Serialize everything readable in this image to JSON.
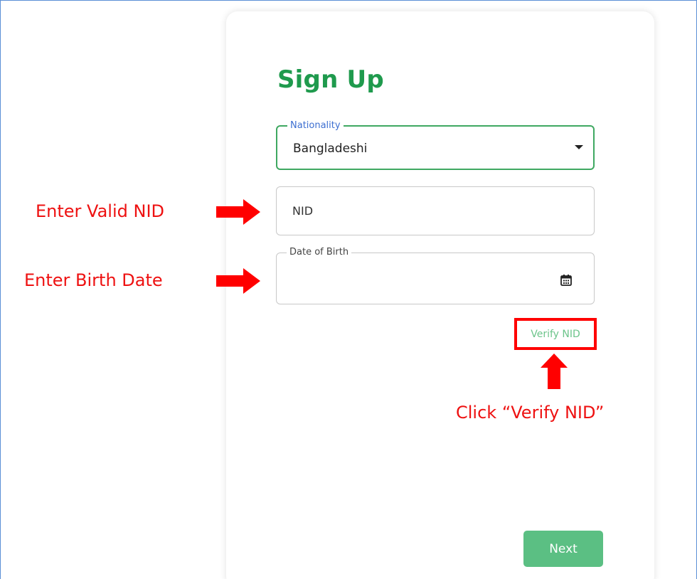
{
  "signup": {
    "title": "Sign Up",
    "nationality": {
      "label": "Nationality",
      "value": "Bangladeshi"
    },
    "nid": {
      "placeholder": "NID",
      "value": ""
    },
    "dob": {
      "label": "Date of Birth",
      "value": ""
    },
    "verify_label": "Verify NID",
    "next_label": "Next"
  },
  "annotations": {
    "nid_hint": "Enter Valid NID",
    "dob_hint": "Enter Birth Date",
    "verify_hint": "Click “Verify NID”"
  },
  "icons": {
    "dropdown": "chevron-down-icon",
    "calendar": "calendar-icon",
    "arrows": "arrow-icon"
  },
  "colors": {
    "brand_green": "#1f9a4d",
    "button_green": "#5bbf83",
    "annotation_red": "#ff0000",
    "legend_blue": "#3d6fd1"
  }
}
